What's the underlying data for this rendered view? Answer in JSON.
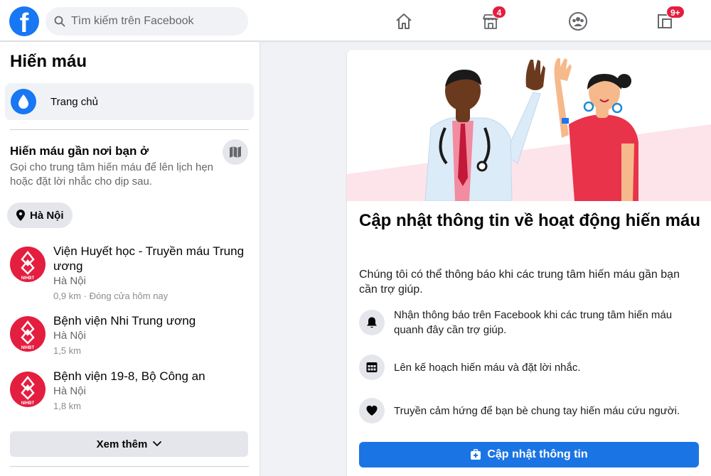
{
  "header": {
    "search_placeholder": "Tìm kiếm trên Facebook",
    "marketplace_badge": "4",
    "gaming_badge": "9+"
  },
  "sidebar": {
    "title": "Hiến máu",
    "home_label": "Trang chủ",
    "near_title": "Hiến máu gần nơi bạn ở",
    "near_description": "Gọi cho trung tâm hiến máu để lên lịch hẹn hoặc đặt lời nhắc cho dịp sau.",
    "location": "Hà Nội",
    "centers": [
      {
        "name": "Viện Huyết học - Truyền máu Trung ương",
        "city": "Hà Nội",
        "meta": "0,9 km · Đóng cửa hôm nay"
      },
      {
        "name": "Bệnh viện Nhi Trung ương",
        "city": "Hà Nội",
        "meta": "1,5 km"
      },
      {
        "name": "Bệnh viện 19-8, Bộ Công an",
        "city": "Hà Nội",
        "meta": "1,8 km"
      }
    ],
    "logo_text": "NIHBT",
    "see_more": "Xem thêm"
  },
  "card": {
    "title": "Cập nhật thông tin về hoạt động hiến máu",
    "description": "Chúng tôi có thể thông báo khi các trung tâm hiến máu gần bạn cần trợ giúp.",
    "features": [
      {
        "icon": "bell-icon",
        "text": "Nhận thông báo trên Facebook khi các trung tâm hiến máu quanh đây cần trợ giúp."
      },
      {
        "icon": "calendar-icon",
        "text": "Lên kế hoạch hiến máu và đặt lời nhắc."
      },
      {
        "icon": "heart-icon",
        "text": "Truyền cảm hứng để bạn bè chung tay hiến máu cứu người."
      }
    ],
    "button_label": "Cập nhật thông tin"
  },
  "colors": {
    "brand_blue": "#1877f2",
    "button_blue": "#1b74e4",
    "badge_red": "#e41e3f",
    "surface_gray": "#f0f2f5"
  }
}
